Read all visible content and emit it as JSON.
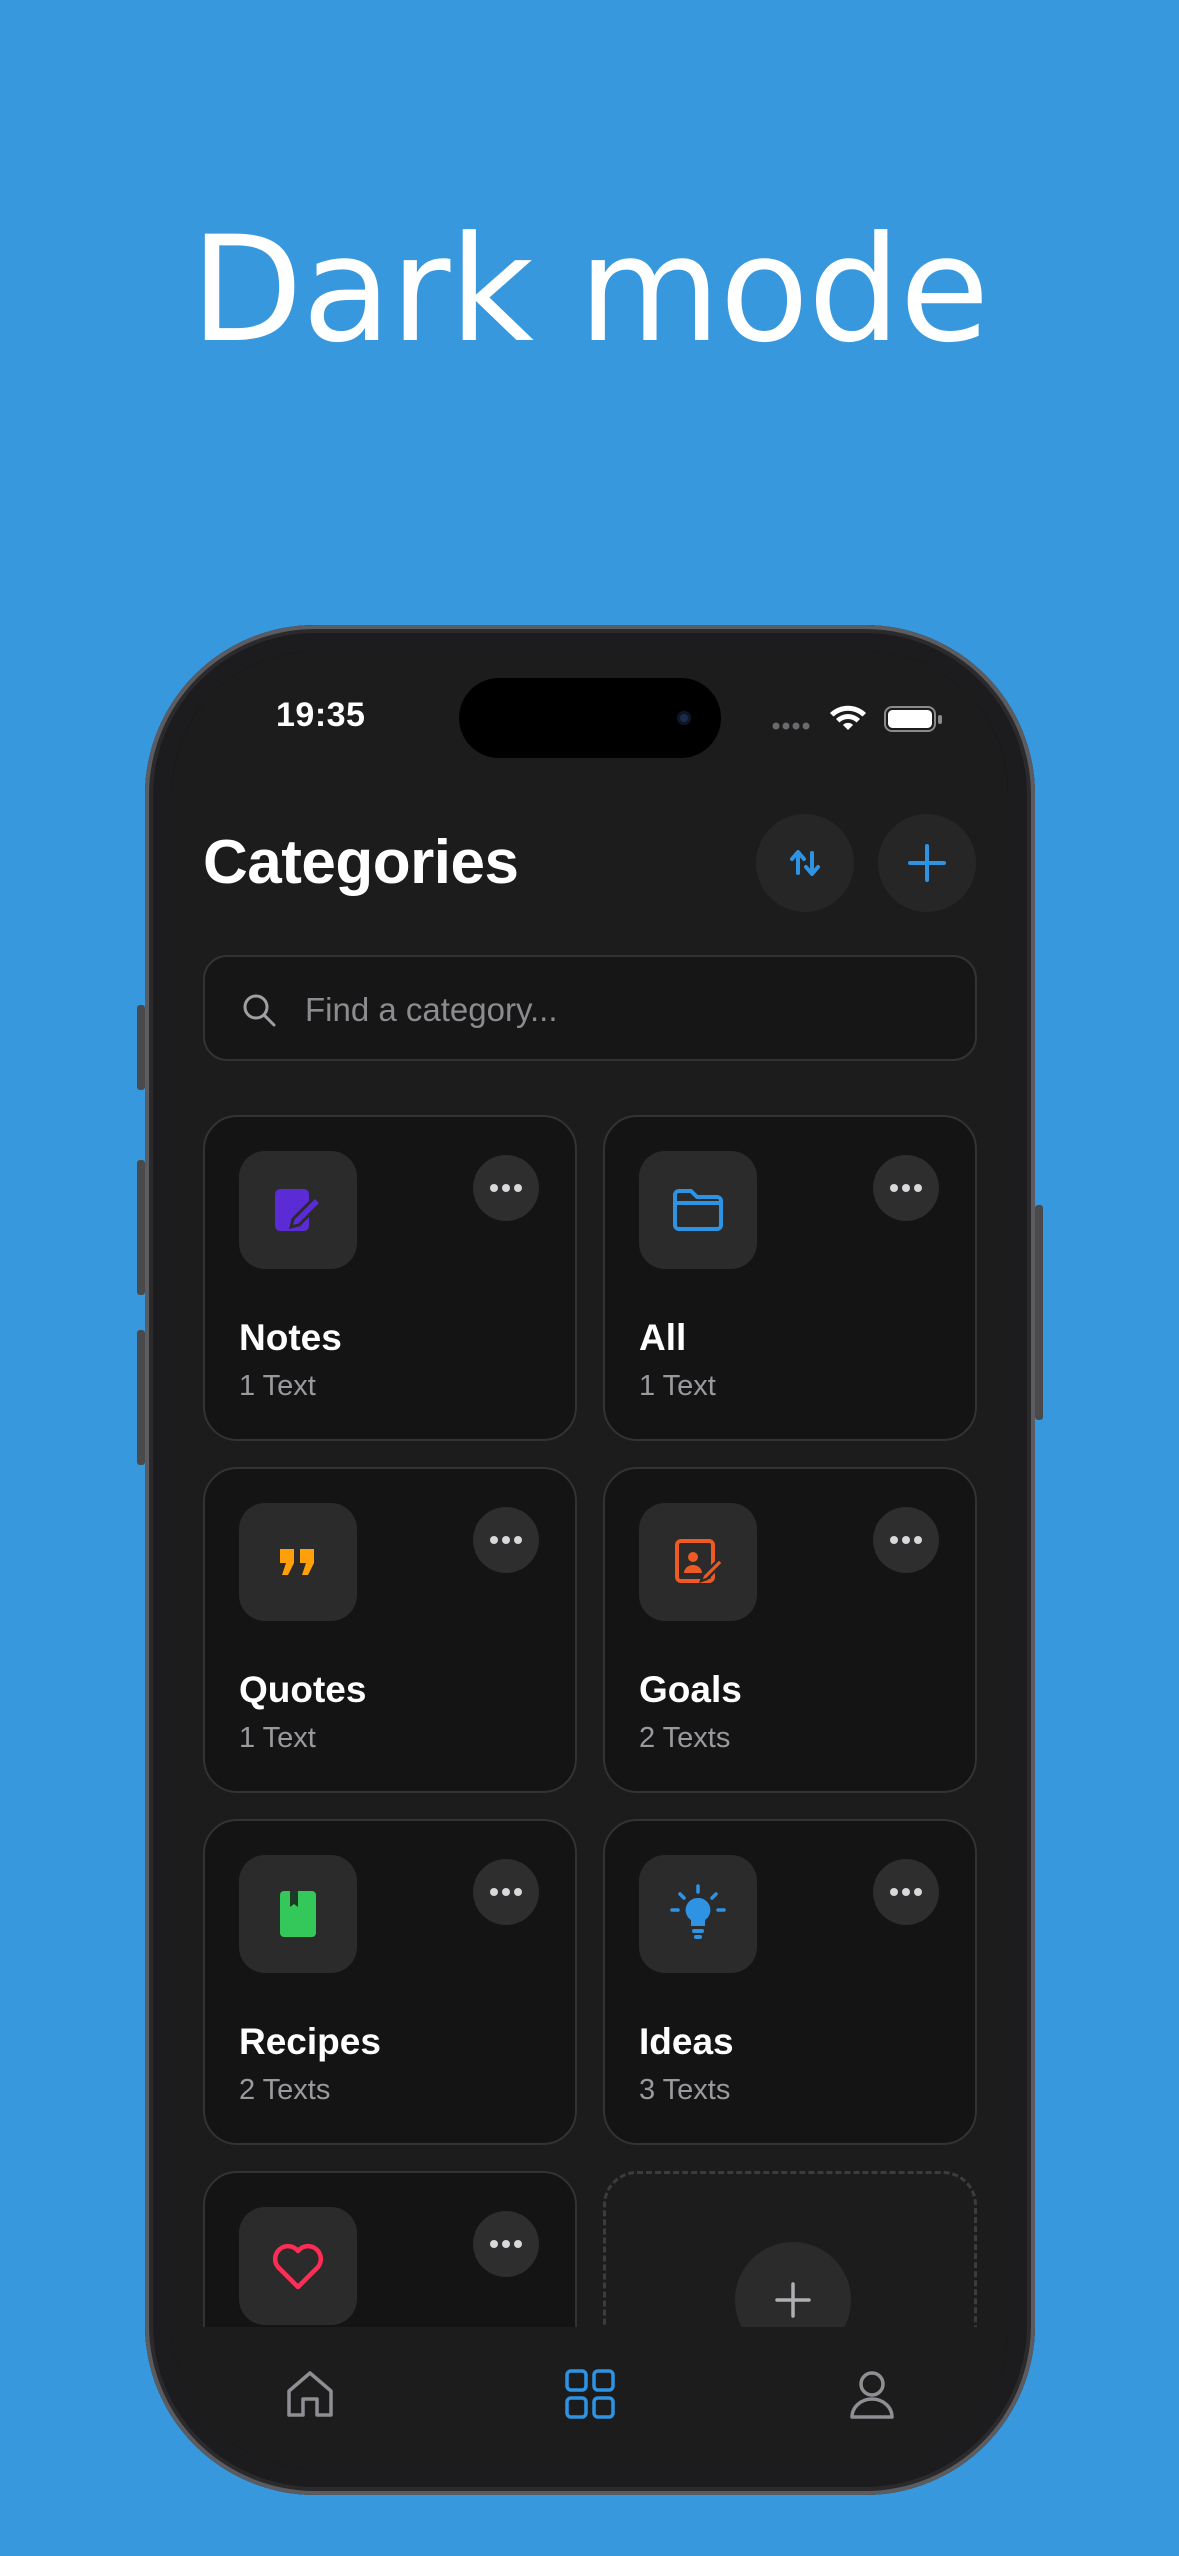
{
  "headline": "Dark mode",
  "status_bar": {
    "time": "19:35"
  },
  "header": {
    "title": "Categories"
  },
  "search": {
    "placeholder": "Find a category..."
  },
  "colors": {
    "background": "#3898dd",
    "accent": "#2f93e4",
    "screen": "#1c1c1c"
  },
  "categories": [
    {
      "name": "Notes",
      "count": "1 Text",
      "icon": "note-edit-icon",
      "color": "#5b2bd6"
    },
    {
      "name": "All",
      "count": "1 Text",
      "icon": "folder-icon",
      "color": "#2f93e4"
    },
    {
      "name": "Quotes",
      "count": "1 Text",
      "icon": "quote-icon",
      "color": "#ff9f0a"
    },
    {
      "name": "Goals",
      "count": "2 Texts",
      "icon": "goal-edit-icon",
      "color": "#ee5a24"
    },
    {
      "name": "Recipes",
      "count": "2 Texts",
      "icon": "book-icon",
      "color": "#34c759"
    },
    {
      "name": "Ideas",
      "count": "3 Texts",
      "icon": "lightbulb-icon",
      "color": "#2f93e4"
    },
    {
      "name": "",
      "count": "",
      "icon": "heart-icon",
      "color": "#ff2d55"
    }
  ],
  "tabbar": {
    "items": [
      {
        "icon": "home-icon",
        "active": false
      },
      {
        "icon": "grid-icon",
        "active": true
      },
      {
        "icon": "profile-icon",
        "active": false
      }
    ]
  }
}
